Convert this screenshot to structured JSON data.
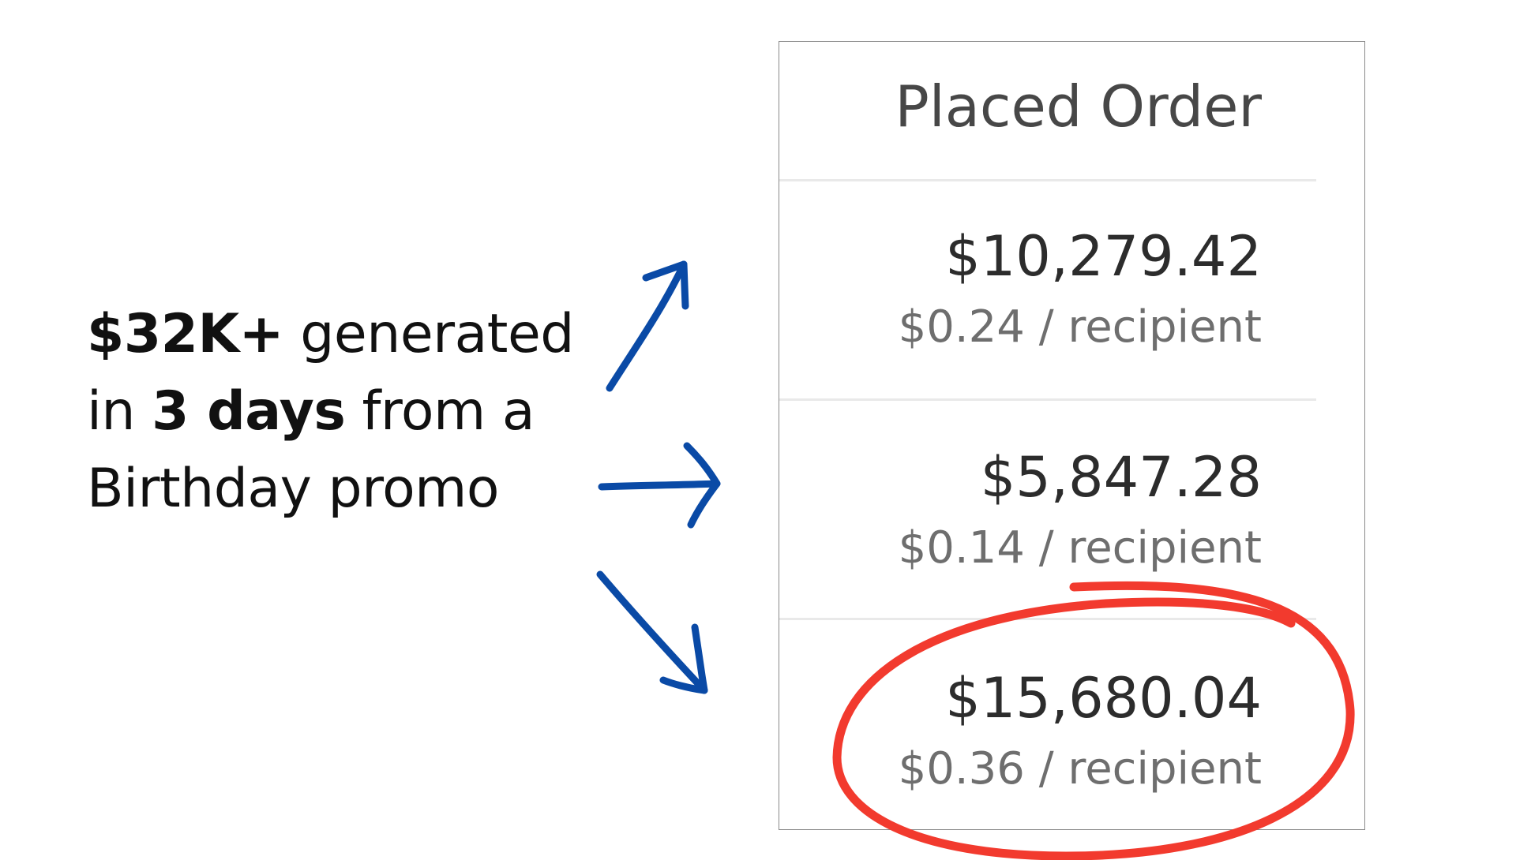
{
  "headline": {
    "line1_bold": "$32K+",
    "line1_rest": " generated",
    "line2_pre": "in ",
    "line2_bold": "3 days",
    "line2_post": " from a",
    "line3": "Birthday promo"
  },
  "table": {
    "header": "Placed Order",
    "rows": [
      {
        "amount": "$10,279.42",
        "per_recipient": "$0.24 / recipient"
      },
      {
        "amount": "$5,847.28",
        "per_recipient": "$0.14 / recipient"
      },
      {
        "amount": "$15,680.04",
        "per_recipient": "$0.36 / recipient",
        "highlighted": true
      }
    ]
  },
  "colors": {
    "arrow": "#0a4aa6",
    "highlight_circle": "#f23a2e",
    "text": "#111111",
    "panel_border": "#8a8a8a"
  },
  "icons": [
    "arrow-up-right-icon",
    "arrow-right-icon",
    "arrow-down-right-icon"
  ]
}
